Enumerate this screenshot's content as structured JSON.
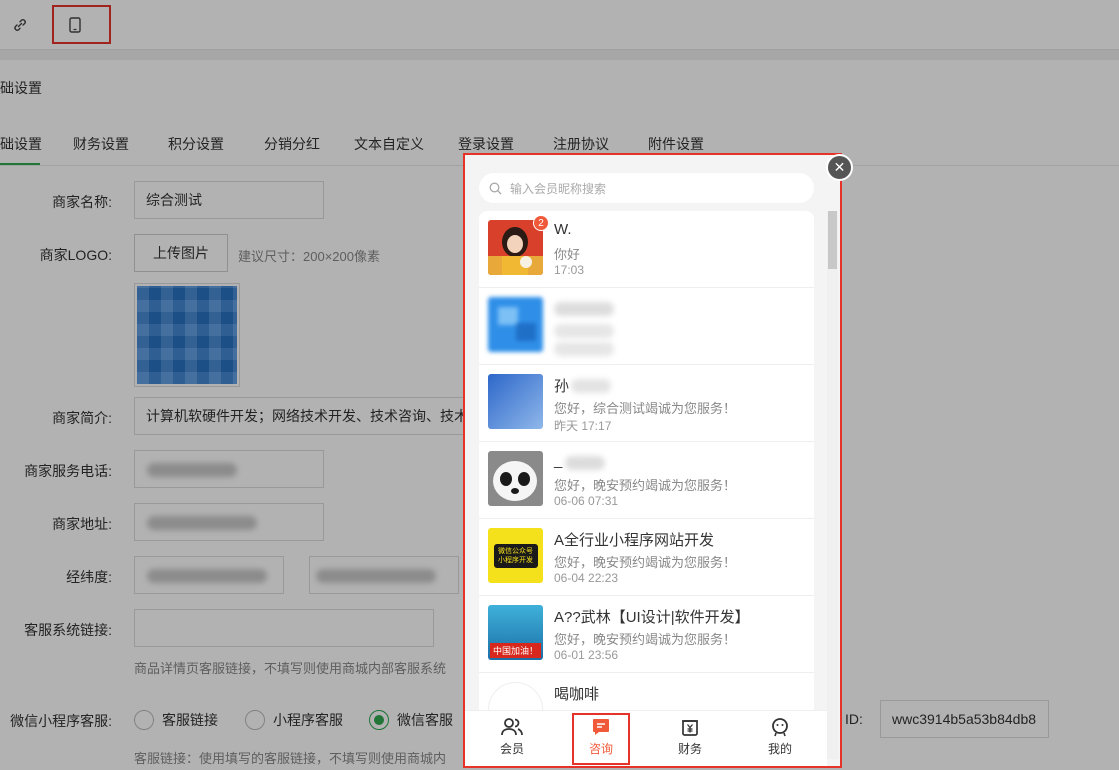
{
  "toolbar": {
    "link_icon": "link-icon",
    "mobile_icon": "mobile-phone-icon"
  },
  "page": {
    "title": "础设置"
  },
  "tabs": [
    {
      "label": "础设置"
    },
    {
      "label": "财务设置"
    },
    {
      "label": "积分设置"
    },
    {
      "label": "分销分红"
    },
    {
      "label": "文本自定义"
    },
    {
      "label": "登录设置"
    },
    {
      "label": "注册协议"
    },
    {
      "label": "附件设置"
    }
  ],
  "form": {
    "merchant_name_label": "商家名称:",
    "merchant_name_value": "综合测试",
    "logo_label": "商家LOGO:",
    "upload_label": "上传图片",
    "logo_hint": "建议尺寸：200×200像素",
    "intro_label": "商家简介:",
    "intro_value": "计算机软硬件开发；网络技术开发、技术咨询、技术",
    "phone_label": "商家服务电话:",
    "address_label": "商家地址:",
    "coords_label": "经纬度:",
    "service_link_label": "客服系统链接:",
    "service_link_hint": "商品详情页客服链接，不填写则使用商城内部客服系统",
    "wechat_service_label": "微信小程序客服:",
    "radio_options": [
      "客服链接",
      "小程序客服",
      "微信客服"
    ],
    "radio_selected": "微信客服",
    "id_label": "ID:",
    "id_value": "wwc3914b5a53b84db8",
    "bottom_hint": "客服链接：使用填写的客服链接，不填写则使用商城内"
  },
  "popup": {
    "search_placeholder": "输入会员昵称搜索",
    "conversations": [
      {
        "name": "W.",
        "message": "你好",
        "time": "17:03",
        "unread": "2"
      },
      {
        "name": "",
        "message": "",
        "time": "",
        "unread": ""
      },
      {
        "name": "孙",
        "message": "您好，综合测试竭诚为您服务！",
        "time": "昨天 17:17",
        "unread": ""
      },
      {
        "name": "_",
        "message": "您好，晚安预约竭诚为您服务！",
        "time": "06-06 07:31",
        "unread": ""
      },
      {
        "name": "A全行业小程序网站开发",
        "message": "您好，晚安预约竭诚为您服务！",
        "time": "06-04 22:23",
        "unread": ""
      },
      {
        "name": "A??武林【UI设计|软件开发】",
        "message": "您好，晚安预约竭诚为您服务！",
        "time": "06-01 23:56",
        "unread": ""
      },
      {
        "name": "喝咖啡",
        "message": "",
        "time": "",
        "unread": ""
      }
    ],
    "avatar_texts": {
      "yellow_line1": "微信公众号",
      "yellow_line2": "小程序开发",
      "blue_caption": "中国加油！"
    },
    "tabbar": [
      {
        "label": "会员",
        "icon": "members-icon"
      },
      {
        "label": "咨询",
        "icon": "chat-icon"
      },
      {
        "label": "财务",
        "icon": "finance-icon"
      },
      {
        "label": "我的",
        "icon": "profile-icon"
      }
    ],
    "active_tab": "咨询"
  }
}
